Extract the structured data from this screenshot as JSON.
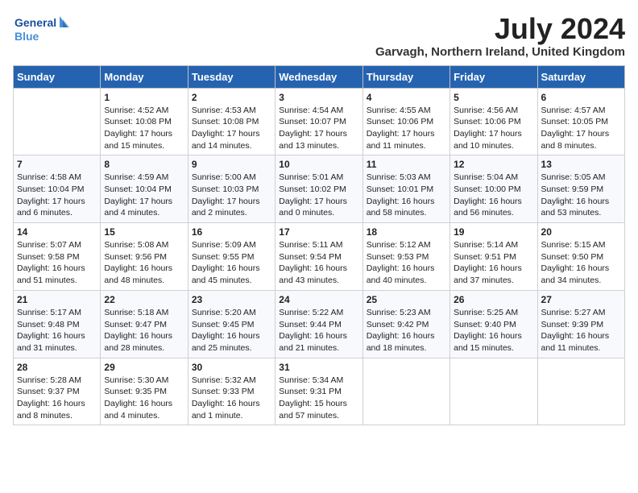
{
  "header": {
    "logo_general": "General",
    "logo_blue": "Blue",
    "month": "July 2024",
    "location": "Garvagh, Northern Ireland, United Kingdom"
  },
  "days_of_week": [
    "Sunday",
    "Monday",
    "Tuesday",
    "Wednesday",
    "Thursday",
    "Friday",
    "Saturday"
  ],
  "weeks": [
    [
      {
        "day": "",
        "content": ""
      },
      {
        "day": "1",
        "content": "Sunrise: 4:52 AM\nSunset: 10:08 PM\nDaylight: 17 hours\nand 15 minutes."
      },
      {
        "day": "2",
        "content": "Sunrise: 4:53 AM\nSunset: 10:08 PM\nDaylight: 17 hours\nand 14 minutes."
      },
      {
        "day": "3",
        "content": "Sunrise: 4:54 AM\nSunset: 10:07 PM\nDaylight: 17 hours\nand 13 minutes."
      },
      {
        "day": "4",
        "content": "Sunrise: 4:55 AM\nSunset: 10:06 PM\nDaylight: 17 hours\nand 11 minutes."
      },
      {
        "day": "5",
        "content": "Sunrise: 4:56 AM\nSunset: 10:06 PM\nDaylight: 17 hours\nand 10 minutes."
      },
      {
        "day": "6",
        "content": "Sunrise: 4:57 AM\nSunset: 10:05 PM\nDaylight: 17 hours\nand 8 minutes."
      }
    ],
    [
      {
        "day": "7",
        "content": "Sunrise: 4:58 AM\nSunset: 10:04 PM\nDaylight: 17 hours\nand 6 minutes."
      },
      {
        "day": "8",
        "content": "Sunrise: 4:59 AM\nSunset: 10:04 PM\nDaylight: 17 hours\nand 4 minutes."
      },
      {
        "day": "9",
        "content": "Sunrise: 5:00 AM\nSunset: 10:03 PM\nDaylight: 17 hours\nand 2 minutes."
      },
      {
        "day": "10",
        "content": "Sunrise: 5:01 AM\nSunset: 10:02 PM\nDaylight: 17 hours\nand 0 minutes."
      },
      {
        "day": "11",
        "content": "Sunrise: 5:03 AM\nSunset: 10:01 PM\nDaylight: 16 hours\nand 58 minutes."
      },
      {
        "day": "12",
        "content": "Sunrise: 5:04 AM\nSunset: 10:00 PM\nDaylight: 16 hours\nand 56 minutes."
      },
      {
        "day": "13",
        "content": "Sunrise: 5:05 AM\nSunset: 9:59 PM\nDaylight: 16 hours\nand 53 minutes."
      }
    ],
    [
      {
        "day": "14",
        "content": "Sunrise: 5:07 AM\nSunset: 9:58 PM\nDaylight: 16 hours\nand 51 minutes."
      },
      {
        "day": "15",
        "content": "Sunrise: 5:08 AM\nSunset: 9:56 PM\nDaylight: 16 hours\nand 48 minutes."
      },
      {
        "day": "16",
        "content": "Sunrise: 5:09 AM\nSunset: 9:55 PM\nDaylight: 16 hours\nand 45 minutes."
      },
      {
        "day": "17",
        "content": "Sunrise: 5:11 AM\nSunset: 9:54 PM\nDaylight: 16 hours\nand 43 minutes."
      },
      {
        "day": "18",
        "content": "Sunrise: 5:12 AM\nSunset: 9:53 PM\nDaylight: 16 hours\nand 40 minutes."
      },
      {
        "day": "19",
        "content": "Sunrise: 5:14 AM\nSunset: 9:51 PM\nDaylight: 16 hours\nand 37 minutes."
      },
      {
        "day": "20",
        "content": "Sunrise: 5:15 AM\nSunset: 9:50 PM\nDaylight: 16 hours\nand 34 minutes."
      }
    ],
    [
      {
        "day": "21",
        "content": "Sunrise: 5:17 AM\nSunset: 9:48 PM\nDaylight: 16 hours\nand 31 minutes."
      },
      {
        "day": "22",
        "content": "Sunrise: 5:18 AM\nSunset: 9:47 PM\nDaylight: 16 hours\nand 28 minutes."
      },
      {
        "day": "23",
        "content": "Sunrise: 5:20 AM\nSunset: 9:45 PM\nDaylight: 16 hours\nand 25 minutes."
      },
      {
        "day": "24",
        "content": "Sunrise: 5:22 AM\nSunset: 9:44 PM\nDaylight: 16 hours\nand 21 minutes."
      },
      {
        "day": "25",
        "content": "Sunrise: 5:23 AM\nSunset: 9:42 PM\nDaylight: 16 hours\nand 18 minutes."
      },
      {
        "day": "26",
        "content": "Sunrise: 5:25 AM\nSunset: 9:40 PM\nDaylight: 16 hours\nand 15 minutes."
      },
      {
        "day": "27",
        "content": "Sunrise: 5:27 AM\nSunset: 9:39 PM\nDaylight: 16 hours\nand 11 minutes."
      }
    ],
    [
      {
        "day": "28",
        "content": "Sunrise: 5:28 AM\nSunset: 9:37 PM\nDaylight: 16 hours\nand 8 minutes."
      },
      {
        "day": "29",
        "content": "Sunrise: 5:30 AM\nSunset: 9:35 PM\nDaylight: 16 hours\nand 4 minutes."
      },
      {
        "day": "30",
        "content": "Sunrise: 5:32 AM\nSunset: 9:33 PM\nDaylight: 16 hours\nand 1 minute."
      },
      {
        "day": "31",
        "content": "Sunrise: 5:34 AM\nSunset: 9:31 PM\nDaylight: 15 hours\nand 57 minutes."
      },
      {
        "day": "",
        "content": ""
      },
      {
        "day": "",
        "content": ""
      },
      {
        "day": "",
        "content": ""
      }
    ]
  ]
}
